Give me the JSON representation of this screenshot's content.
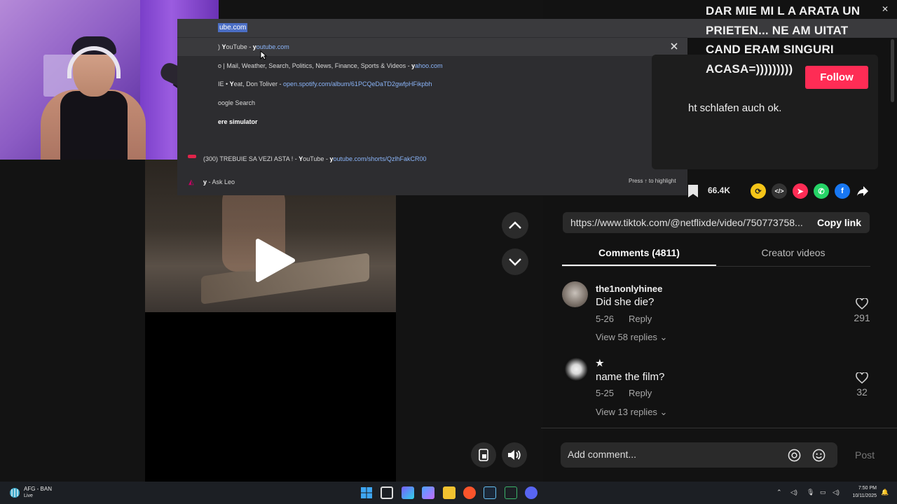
{
  "omnibox": {
    "input_text": "ube.com",
    "suggestions": [
      {
        "prefix": ") ",
        "bold": "Y",
        "title": "ouTube",
        "sep": " - ",
        "url_bold": "y",
        "url": "outube.com"
      },
      {
        "title": "o | Mail, Weather, Search, Politics, News, Finance, Sports & Videos",
        "sep": " - ",
        "url_bold": "y",
        "url": "ahoo.com"
      },
      {
        "title_pre": "IE • ",
        "bold": "Y",
        "title": "eat, Don Toliver",
        "sep": " - ",
        "url": "open.spotify.com/album/61PCQeDaTD2gwfpHFikpbh"
      },
      {
        "title": "oogle Search"
      },
      {
        "title": "ere simulator"
      },
      {
        "title": "(300) TREBUIE SA VEZI ASTA ! - ",
        "bold": "Y",
        "title2": "ouTube",
        "sep": " - ",
        "url_bold": "y",
        "url": "outube.com/shorts/QzlhFakCR00"
      },
      {
        "bold_q": "y",
        "title": " - Ask Leo"
      }
    ],
    "press_hint": "Press ↑ to highlight"
  },
  "caption": {
    "lines": [
      "DAR MIE MI L A ARATA UN",
      "PRIETEN... NE AM UITAT",
      "CAND ERAM SINGURI",
      "ACASA=)))))))))"
    ]
  },
  "follow_label": "Follow",
  "description_text": "ht schlafen auch ok.",
  "actions": {
    "bookmark_count": "66.4K"
  },
  "copy_link": {
    "url": "https://www.tiktok.com/@netflixde/video/750773758...",
    "button": "Copy link"
  },
  "tabs": {
    "comments": "Comments (4811)",
    "creator": "Creator videos"
  },
  "comments": [
    {
      "user": "the1nonlyhinee",
      "text": "Did she die?",
      "date": "5-26",
      "reply": "Reply",
      "view": "View 58 replies",
      "likes": "291"
    },
    {
      "user": "★",
      "text": "name the film?",
      "date": "5-25",
      "reply": "Reply",
      "view": "View 13 replies",
      "likes": "32"
    }
  ],
  "add_comment": {
    "placeholder": "Add comment...",
    "post": "Post"
  },
  "taskbar": {
    "weather_title": "AFG - BAN",
    "weather_sub": "Live",
    "time": "7:50 PM",
    "date": "10/11/2025"
  },
  "colors": {
    "accent": "#fe2c55",
    "link": "#8ab4f8",
    "bg": "#121212"
  }
}
